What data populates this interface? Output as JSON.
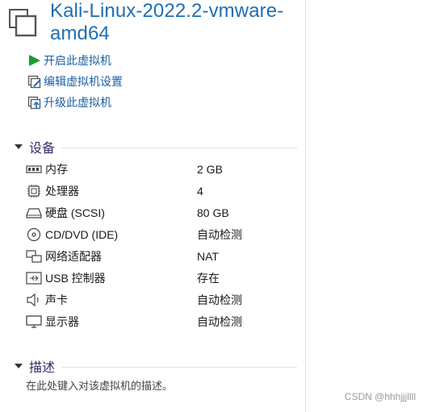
{
  "vm": {
    "title": "Kali-Linux-2022.2-vmware-amd64"
  },
  "actions": [
    {
      "label": "开启此虚拟机",
      "icon": "play-icon"
    },
    {
      "label": "编辑虚拟机设置",
      "icon": "edit-settings-icon"
    },
    {
      "label": "升级此虚拟机",
      "icon": "upgrade-icon"
    }
  ],
  "devices_section": {
    "title": "设备"
  },
  "devices": [
    {
      "name": "内存",
      "value": "2 GB",
      "icon": "memory-icon"
    },
    {
      "name": "处理器",
      "value": "4",
      "icon": "cpu-icon"
    },
    {
      "name": "硬盘 (SCSI)",
      "value": "80 GB",
      "icon": "harddisk-icon"
    },
    {
      "name": "CD/DVD (IDE)",
      "value": "自动检测",
      "icon": "cd-icon"
    },
    {
      "name": "网络适配器",
      "value": "NAT",
      "icon": "network-icon"
    },
    {
      "name": "USB 控制器",
      "value": "存在",
      "icon": "usb-icon"
    },
    {
      "name": "声卡",
      "value": "自动检测",
      "icon": "speaker-icon"
    },
    {
      "name": "显示器",
      "value": "自动检测",
      "icon": "display-icon"
    }
  ],
  "description_section": {
    "title": "描述",
    "placeholder": "在此处键入对该虚拟机的描述。"
  },
  "watermark": "CSDN @hhhjjjllll",
  "colors": {
    "title": "#1f6fb2",
    "link": "#1b5fa6",
    "section": "#3d2b6b",
    "play": "#1a9b2e"
  }
}
